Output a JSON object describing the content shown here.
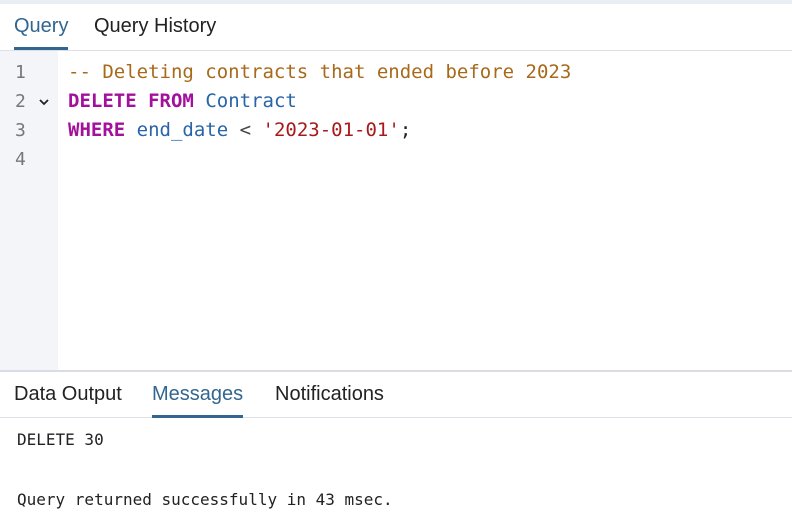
{
  "editor_tabs": [
    {
      "label": "Query",
      "active": true
    },
    {
      "label": "Query History",
      "active": false
    }
  ],
  "editor": {
    "line_numbers": [
      "1",
      "2",
      "3",
      "4"
    ],
    "fold_icon": "chevron-down-icon",
    "line1": {
      "comment": "-- Deleting contracts that ended before 2023"
    },
    "line2": {
      "kw1": "DELETE",
      "kw2": "FROM",
      "table": "Contract"
    },
    "line3": {
      "kw": "WHERE",
      "column": "end_date",
      "op": "<",
      "value": "'2023-01-01'",
      "terminator": ";"
    }
  },
  "result_tabs": [
    {
      "label": "Data Output",
      "active": false
    },
    {
      "label": "Messages",
      "active": true
    },
    {
      "label": "Notifications",
      "active": false
    }
  ],
  "messages": {
    "line1": "DELETE 30",
    "line2": "Query returned successfully in 43 msec."
  },
  "colors": {
    "accent": "#326690",
    "keyword": "#a3119c",
    "comment": "#a8691a",
    "identifier": "#2864a8",
    "string": "#a81a1a"
  }
}
